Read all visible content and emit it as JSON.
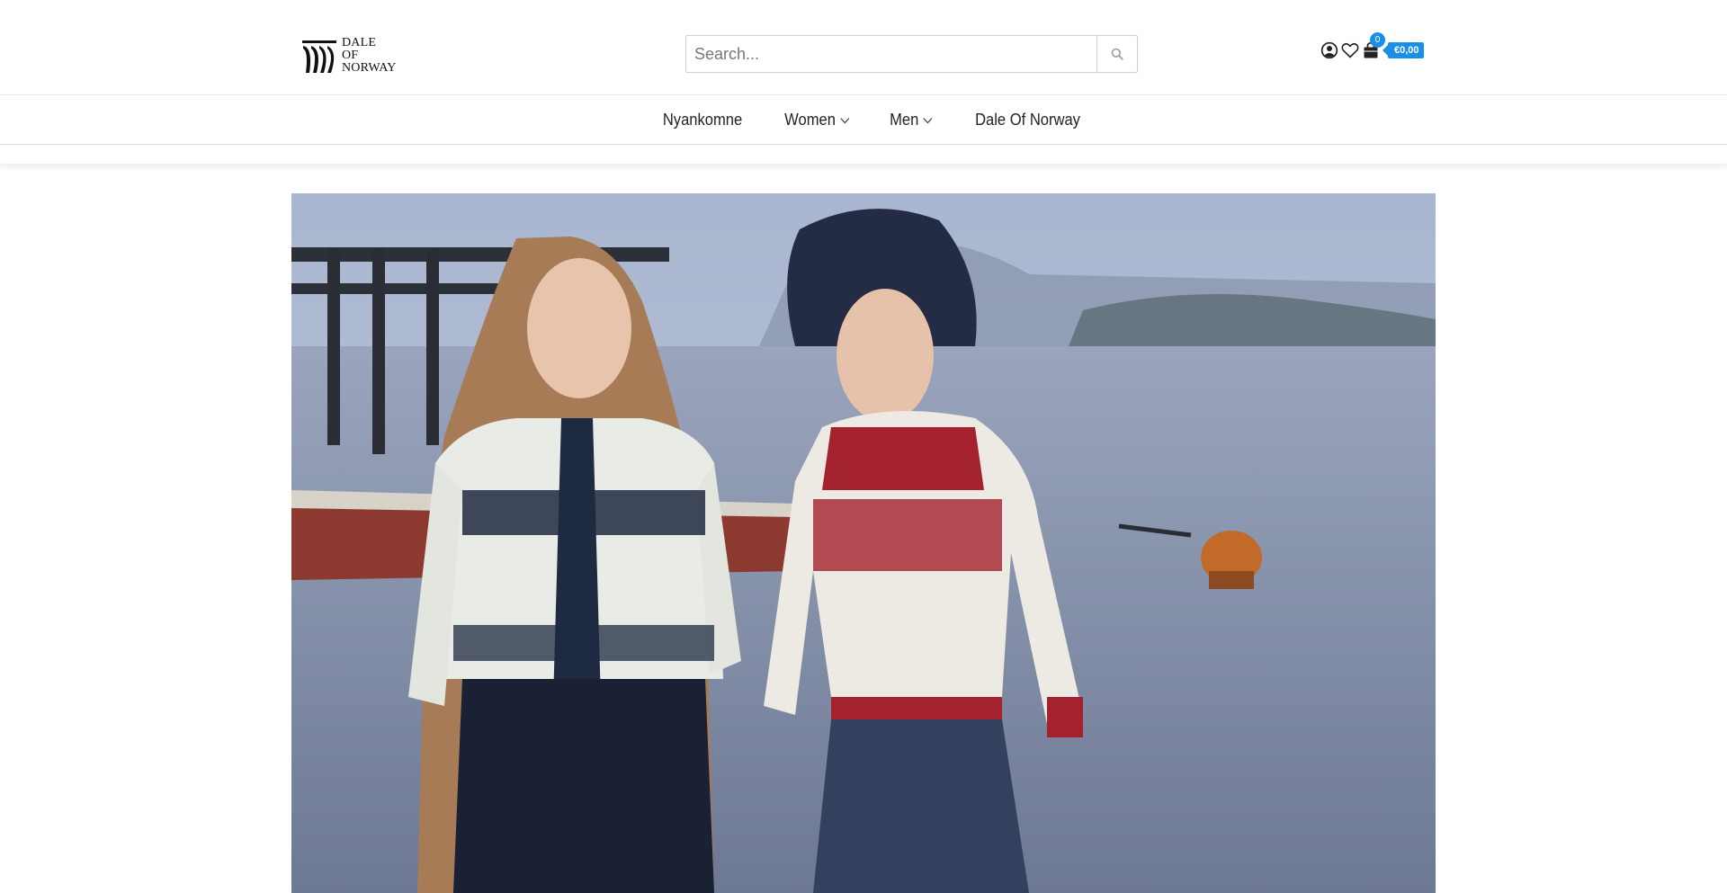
{
  "brand": {
    "logo_lines": [
      "DALE",
      "OF",
      "NORWAY"
    ],
    "logo_icon": "dale-of-norway-logo-icon"
  },
  "search": {
    "placeholder": "Search...",
    "icon": "search-icon"
  },
  "header_icons": {
    "account": "user-circle-icon",
    "wishlist": "heart-icon",
    "cart": "shopping-bag-icon",
    "cart_count": "0",
    "cart_total": "€0,00"
  },
  "nav": {
    "items": [
      {
        "label": "Nyankomne",
        "has_dropdown": false
      },
      {
        "label": "Women",
        "has_dropdown": true
      },
      {
        "label": "Men",
        "has_dropdown": true
      },
      {
        "label": "Dale Of Norway",
        "has_dropdown": false
      }
    ]
  },
  "colors": {
    "accent": "#1a8fe8",
    "text": "#222222",
    "border": "#dcdcdc"
  }
}
